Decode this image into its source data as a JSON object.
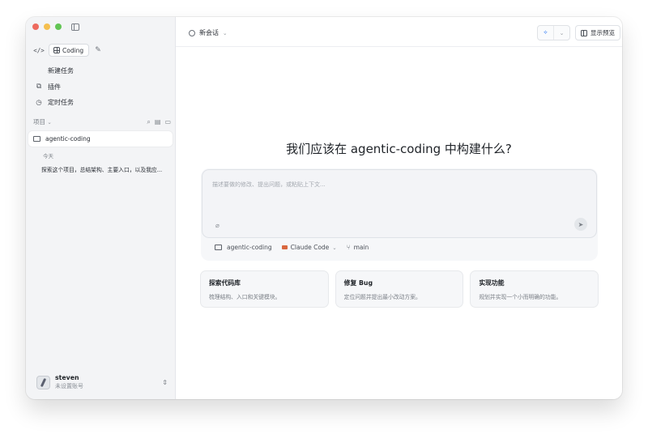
{
  "sidebar": {
    "mode_label": "Coding",
    "nav": [
      {
        "label": "新建任务",
        "icon": "compose-icon"
      },
      {
        "label": "插件",
        "icon": "plugin-icon"
      },
      {
        "label": "定时任务",
        "icon": "clock-icon"
      }
    ],
    "projects_label": "项目",
    "project_name": "agentic-coding",
    "group_label": "今天",
    "session_title": "探索这个项目，总结架构、主要入口，以及我应...",
    "user": {
      "name": "steven",
      "subtitle": "未设置账号"
    }
  },
  "topbar": {
    "session_name": "新会话",
    "preview_label": "显示预览"
  },
  "main": {
    "headline": "我们应该在 agentic-coding 中构建什么?",
    "composer": {
      "placeholder": "描述要做的修改、提出问题，或粘贴上下文...",
      "folder": "agentic-coding",
      "model": "Claude Code",
      "branch": "main"
    },
    "cards": [
      {
        "title": "探索代码库",
        "desc": "梳理结构、入口和关键模块。"
      },
      {
        "title": "修复 Bug",
        "desc": "定位问题并提出最小改动方案。"
      },
      {
        "title": "实现功能",
        "desc": "规划并实现一个小而明确的功能。"
      }
    ]
  },
  "colors": {
    "accent": "#3b82f6",
    "claude": "#d9673f"
  }
}
